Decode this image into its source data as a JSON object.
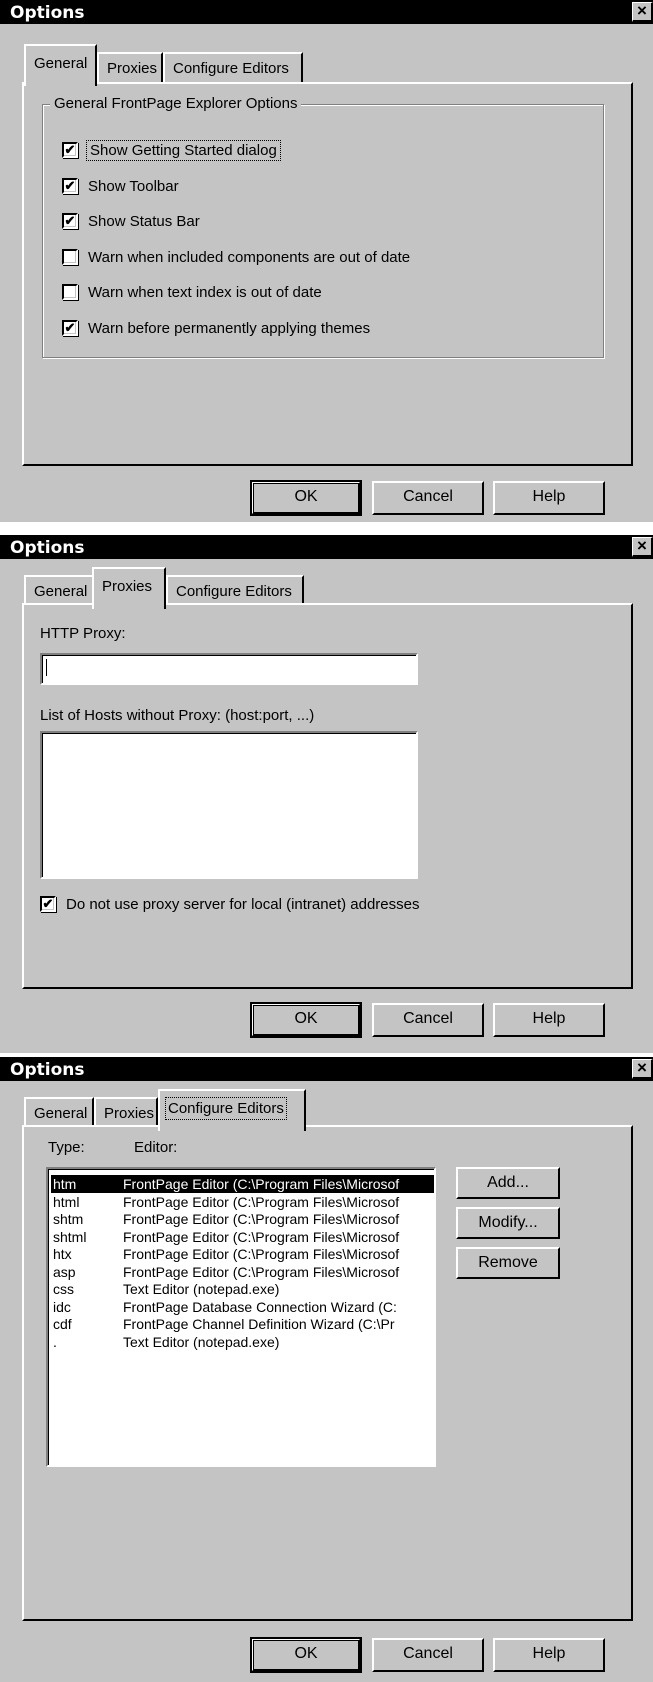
{
  "dialogs": [
    {
      "title": "Options",
      "tabs": [
        "General",
        "Proxies",
        "Configure Editors"
      ],
      "active_tab": "General"
    },
    {
      "title": "Options",
      "tabs": [
        "General",
        "Proxies",
        "Configure Editors"
      ],
      "active_tab": "Proxies"
    },
    {
      "title": "Options",
      "tabs": [
        "General",
        "Proxies",
        "Configure Editors"
      ],
      "active_tab": "Configure Editors"
    }
  ],
  "close_glyph": "×",
  "general": {
    "group_title": "General FrontPage Explorer Options",
    "options": [
      {
        "label": "Show Getting Started dialog",
        "checked": true
      },
      {
        "label": "Show Toolbar",
        "checked": true
      },
      {
        "label": "Show Status Bar",
        "checked": true
      },
      {
        "label": "Warn when included components are out of date",
        "checked": false
      },
      {
        "label": "Warn when text index is out of date",
        "checked": false
      },
      {
        "label": "Warn before permanently applying themes",
        "checked": true
      }
    ]
  },
  "proxies": {
    "http_proxy_label": "HTTP Proxy:",
    "http_proxy_value": "",
    "hosts_label": "List of Hosts without Proxy:  (host:port, ...)",
    "hosts_value": "",
    "local_bypass_label": "Do not use proxy server for local (intranet) addresses",
    "local_bypass_checked": true
  },
  "editors": {
    "col_type": "Type:",
    "col_editor": "Editor:",
    "rows": [
      {
        "type": "htm",
        "editor": "FrontPage Editor (C:\\Program Files\\Microsof"
      },
      {
        "type": "html",
        "editor": "FrontPage Editor (C:\\Program Files\\Microsof"
      },
      {
        "type": "shtm",
        "editor": "FrontPage Editor (C:\\Program Files\\Microsof"
      },
      {
        "type": "shtml",
        "editor": "FrontPage Editor (C:\\Program Files\\Microsof"
      },
      {
        "type": "htx",
        "editor": "FrontPage Editor (C:\\Program Files\\Microsof"
      },
      {
        "type": "asp",
        "editor": "FrontPage Editor (C:\\Program Files\\Microsof"
      },
      {
        "type": "css",
        "editor": "Text Editor (notepad.exe)"
      },
      {
        "type": "idc",
        "editor": "FrontPage Database Connection Wizard (C:"
      },
      {
        "type": "cdf",
        "editor": "FrontPage Channel Definition Wizard (C:\\Pr"
      },
      {
        "type": ".",
        "editor": "Text Editor (notepad.exe)"
      }
    ],
    "selected_row": 0,
    "add_label": "Add...",
    "modify_label": "Modify...",
    "remove_label": "Remove"
  },
  "buttons": {
    "ok": "OK",
    "cancel": "Cancel",
    "help": "Help"
  }
}
